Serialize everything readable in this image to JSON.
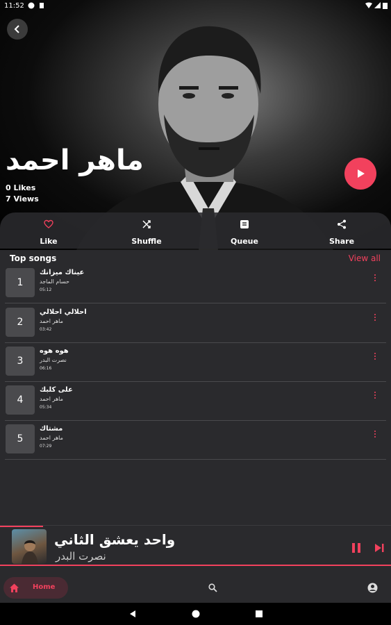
{
  "status_bar": {
    "time": "11:52"
  },
  "artist": {
    "name": "ماهر احمد",
    "likes": "0 Likes",
    "views": "7 Views"
  },
  "actions": [
    {
      "label": "Like",
      "icon": "heart-outline-icon"
    },
    {
      "label": "Shuffle",
      "icon": "shuffle-icon"
    },
    {
      "label": "Queue",
      "icon": "queue-icon"
    },
    {
      "label": "Share",
      "icon": "share-icon"
    }
  ],
  "top_songs": {
    "title": "Top songs",
    "view_all": "View all",
    "items": [
      {
        "rank": "1",
        "title": "عيناك ميزانك",
        "artist": "حسام الماجد",
        "duration": "05:12"
      },
      {
        "rank": "2",
        "title": "احلالي احلالي",
        "artist": "ماهر احمد",
        "duration": "03:42"
      },
      {
        "rank": "3",
        "title": "هوه هوه",
        "artist": "نصرت البدر",
        "duration": "06:16"
      },
      {
        "rank": "4",
        "title": "على كلبك",
        "artist": "ماهر احمد",
        "duration": "05:34"
      },
      {
        "rank": "5",
        "title": "مشتاك",
        "artist": "ماهر احمد",
        "duration": "07:29"
      }
    ]
  },
  "now_playing": {
    "title": "واحد يعشق الثاني",
    "artist": "نصرت البدر",
    "progress_fraction": 0.11
  },
  "bottom_nav": {
    "home_label": "Home"
  },
  "colors": {
    "accent": "#f2415d",
    "background": "#2a2a2d",
    "divider": "#4a4a4d"
  }
}
